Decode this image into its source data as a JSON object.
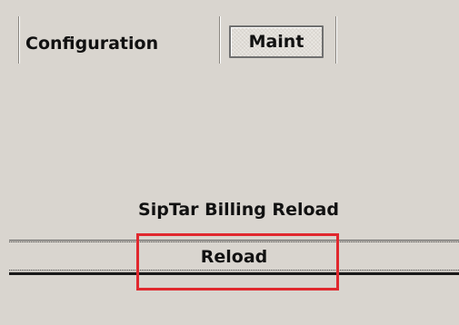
{
  "tabs": [
    {
      "label": "Configuration",
      "selected": false
    },
    {
      "label": "Maint",
      "selected": true
    }
  ],
  "section": {
    "title": "SipTar Billing Reload"
  },
  "actions": {
    "reload_label": "Reload"
  },
  "colors": {
    "background": "#d9d5cf",
    "highlight": "#e0282e"
  }
}
